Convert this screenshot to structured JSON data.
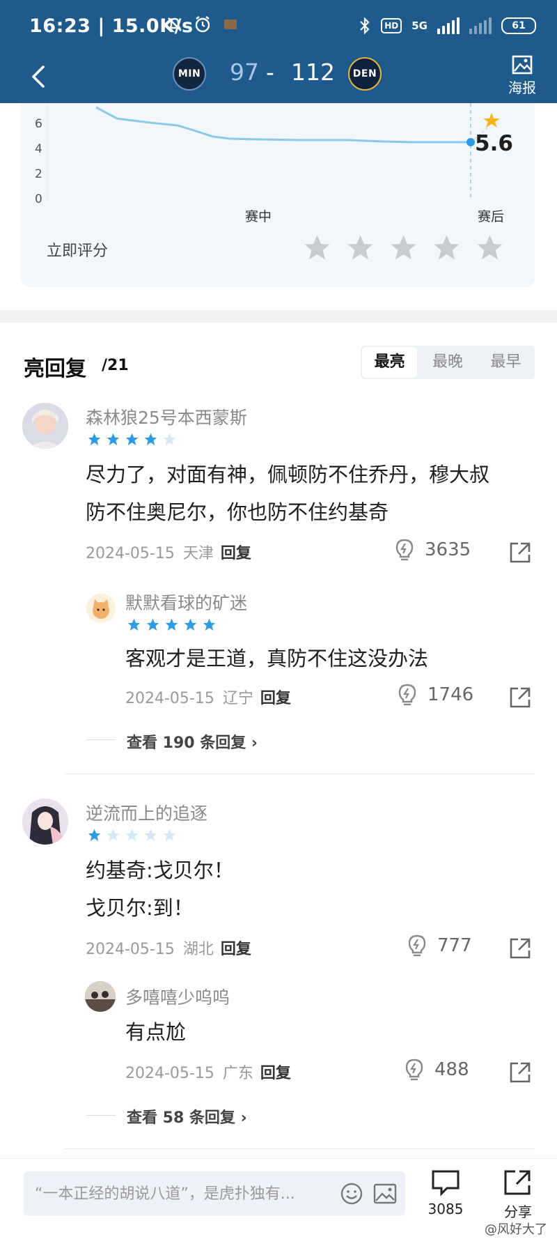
{
  "status_bar": {
    "time": "16:23 | 15.0K/s",
    "network": "5G",
    "hd": "HD",
    "battery": "61"
  },
  "header": {
    "home_team": "MIN",
    "away_team": "DEN",
    "home_score": "97",
    "dash": "-",
    "away_score": "112",
    "poster_label": "海报",
    "colors": {
      "bar": "#1f5a8c",
      "home_score": "#a9c6e6"
    }
  },
  "rating_chart": {
    "y_ticks": [
      "6",
      "4",
      "2",
      "0"
    ],
    "x_labels": [
      "赛中",
      "赛后"
    ],
    "final_value": "5.6",
    "rate_prompt": "立即评分",
    "star_count": 5,
    "line_color": "#8ec9ea"
  },
  "comments_header": {
    "title": "亮回复",
    "count": "/21",
    "sort_tabs": [
      "最亮",
      "最晚",
      "最早"
    ],
    "active_tab": "最亮"
  },
  "comments": [
    {
      "user": "森林狼25号本西蒙斯",
      "rating": 4,
      "lines": [
        "尽力了，对面有神，佩顿防不住乔丹，穆大叔",
        "防不住奥尼尔，你也防不住约基奇"
      ],
      "date": "2024-05-15",
      "location": "天津",
      "reply_label": "回复",
      "likes": "3635",
      "sub_reply": {
        "user": "默默看球的矿迷",
        "rating": 5,
        "text": "客观才是王道，真防不住这没办法",
        "date": "2024-05-15",
        "location": "辽宁",
        "reply_label": "回复",
        "likes": "1746"
      },
      "more_replies": "查看 190 条回复 ›"
    },
    {
      "user": "逆流而上的追逐",
      "rating": 1,
      "lines": [
        "约基奇:戈贝尔！",
        "戈贝尔:到！"
      ],
      "date": "2024-05-15",
      "location": "湖北",
      "reply_label": "回复",
      "likes": "777",
      "sub_reply": {
        "user": "多嘻嘻少呜呜",
        "rating": 0,
        "text": "有点尬",
        "date": "2024-05-15",
        "location": "广东",
        "reply_label": "回复",
        "likes": "488"
      },
      "more_replies": "查看 58 条回复 ›"
    }
  ],
  "bottom_bar": {
    "input_placeholder": "“一本正经的胡说八道”，是虎扑独有...",
    "comment_count": "3085",
    "share_label": "分享",
    "watermark": "@风好大了"
  },
  "accent": {
    "star_blue": "#2d9be6",
    "star_empty": "#d3e7f7",
    "star_gold": "#f6b619"
  }
}
